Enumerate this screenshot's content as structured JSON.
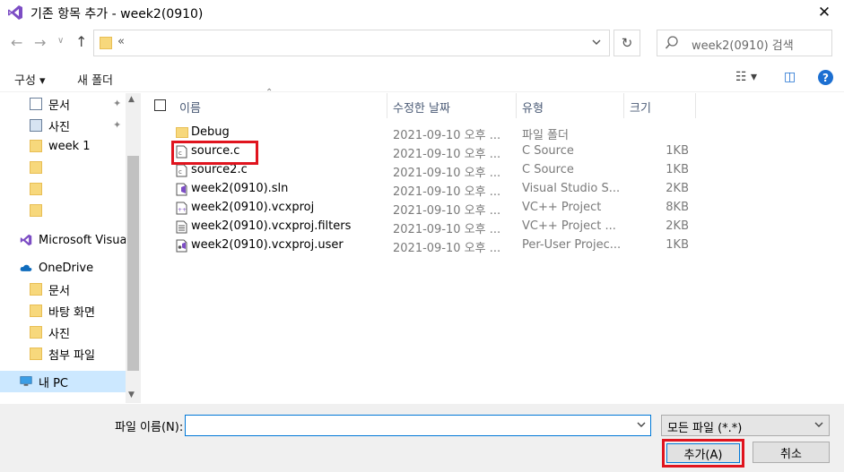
{
  "window": {
    "title": "기존 항목 추가 - week2(0910)",
    "close_symbol": "✕"
  },
  "nav": {
    "back_icon": "←",
    "forward_icon": "→",
    "history_icon": "∨",
    "up_icon": "↑"
  },
  "address": {
    "crumb": "«",
    "refresh_symbol": "↻"
  },
  "search": {
    "placeholder": "week2(0910) 검색"
  },
  "toolbar": {
    "organize_label": "구성 ▾",
    "new_folder_label": "새 폴더",
    "view_symbol": "☷ ▾",
    "pane_symbol": "◫",
    "help_symbol": "?"
  },
  "sidebar": {
    "items": [
      {
        "label": "문서",
        "icon": "document-icon",
        "pinned": true
      },
      {
        "label": "사진",
        "icon": "picture-icon",
        "pinned": true
      },
      {
        "label": "week 1",
        "icon": "folder-icon"
      },
      {
        "label": "",
        "icon": "folder-icon"
      },
      {
        "label": "",
        "icon": "folder-icon"
      },
      {
        "label": "",
        "icon": "folder-icon"
      },
      {
        "label": "Microsoft Visual",
        "icon": "visual-studio-icon"
      },
      {
        "label": "OneDrive",
        "icon": "onedrive-icon"
      },
      {
        "label": "문서",
        "icon": "folder-icon"
      },
      {
        "label": "바탕 화면",
        "icon": "folder-icon"
      },
      {
        "label": "사진",
        "icon": "folder-icon"
      },
      {
        "label": "첨부 파일",
        "icon": "folder-icon"
      },
      {
        "label": "내 PC",
        "icon": "pc-icon",
        "selected": true
      }
    ],
    "pin_symbol": "📌"
  },
  "columns": {
    "name": "이름",
    "modified": "수정한 날짜",
    "type": "유형",
    "size": "크기"
  },
  "files": [
    {
      "name": "Debug",
      "modified": "2021-09-10 오후 ...",
      "type": "파일 폴더",
      "size": "",
      "icon": "folder-icon"
    },
    {
      "name": "source.c",
      "modified": "2021-09-10 오후 ...",
      "type": "C Source",
      "size": "1KB",
      "icon": "c-file-icon"
    },
    {
      "name": "source2.c",
      "modified": "2021-09-10 오후 ...",
      "type": "C Source",
      "size": "1KB",
      "icon": "c-file-icon"
    },
    {
      "name": "week2(0910).sln",
      "modified": "2021-09-10 오후 ...",
      "type": "Visual Studio S...",
      "size": "2KB",
      "icon": "sln-file-icon"
    },
    {
      "name": "week2(0910).vcxproj",
      "modified": "2021-09-10 오후 ...",
      "type": "VC++ Project",
      "size": "8KB",
      "icon": "vcxproj-file-icon"
    },
    {
      "name": "week2(0910).vcxproj.filters",
      "modified": "2021-09-10 오후 ...",
      "type": "VC++ Project ...",
      "size": "2KB",
      "icon": "filters-file-icon"
    },
    {
      "name": "week2(0910).vcxproj.user",
      "modified": "2021-09-10 오후 ...",
      "type": "Per-User Projec...",
      "size": "1KB",
      "icon": "user-file-icon"
    }
  ],
  "footer": {
    "filename_label": "파일 이름(N):",
    "filename_value": "",
    "filter_value": "모든 파일 (*.*)",
    "add_label": "추가(A)",
    "cancel_label": "취소"
  },
  "colors": {
    "accent": "#0078d7",
    "highlight": "#e0141e",
    "selected": "#cce8ff"
  }
}
